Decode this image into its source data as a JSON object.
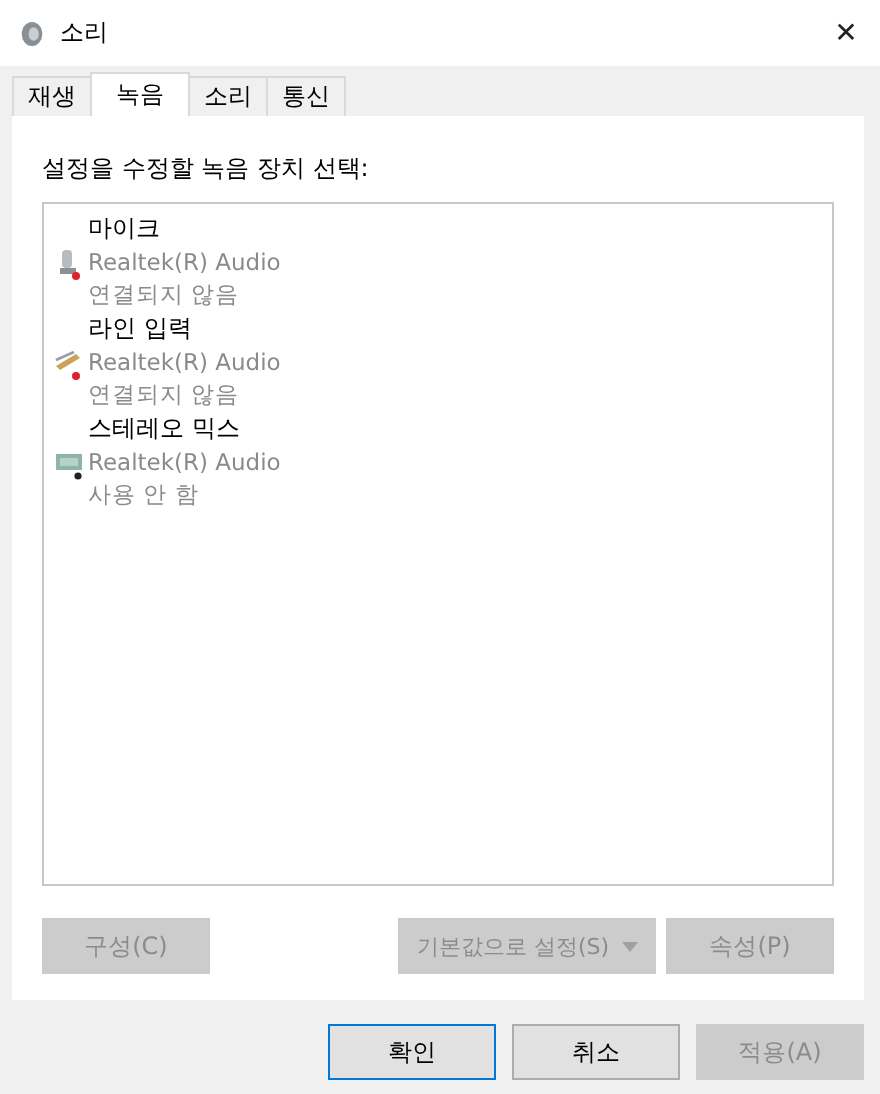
{
  "window": {
    "title": "소리",
    "close": "✕"
  },
  "tabs": [
    {
      "label": "재생",
      "selected": false
    },
    {
      "label": "녹음",
      "selected": true
    },
    {
      "label": "소리",
      "selected": false
    },
    {
      "label": "통신",
      "selected": false
    }
  ],
  "instruction": "설정을 수정할 녹음 장치 선택:",
  "devices": [
    {
      "kind": "microphone",
      "name": "마이크",
      "driver": "Realtek(R) Audio",
      "status": "연결되지 않음"
    },
    {
      "kind": "line-in",
      "name": "라인 입력",
      "driver": "Realtek(R) Audio",
      "status": "연결되지 않음"
    },
    {
      "kind": "stereo-mix",
      "name": "스테레오 믹스",
      "driver": "Realtek(R) Audio",
      "status": "사용 안 함"
    }
  ],
  "panel_buttons": [
    {
      "label": "구성(C)",
      "disabled": true,
      "dropdown": false
    },
    {
      "label": "기본값으로 설정(S)",
      "disabled": true,
      "dropdown": true
    },
    {
      "label": "속성(P)",
      "disabled": true,
      "dropdown": false
    }
  ],
  "dialog_buttons": [
    {
      "label": "확인",
      "disabled": false,
      "default": true
    },
    {
      "label": "취소",
      "disabled": false,
      "default": false
    },
    {
      "label": "적용(A)",
      "disabled": true,
      "default": false
    }
  ]
}
